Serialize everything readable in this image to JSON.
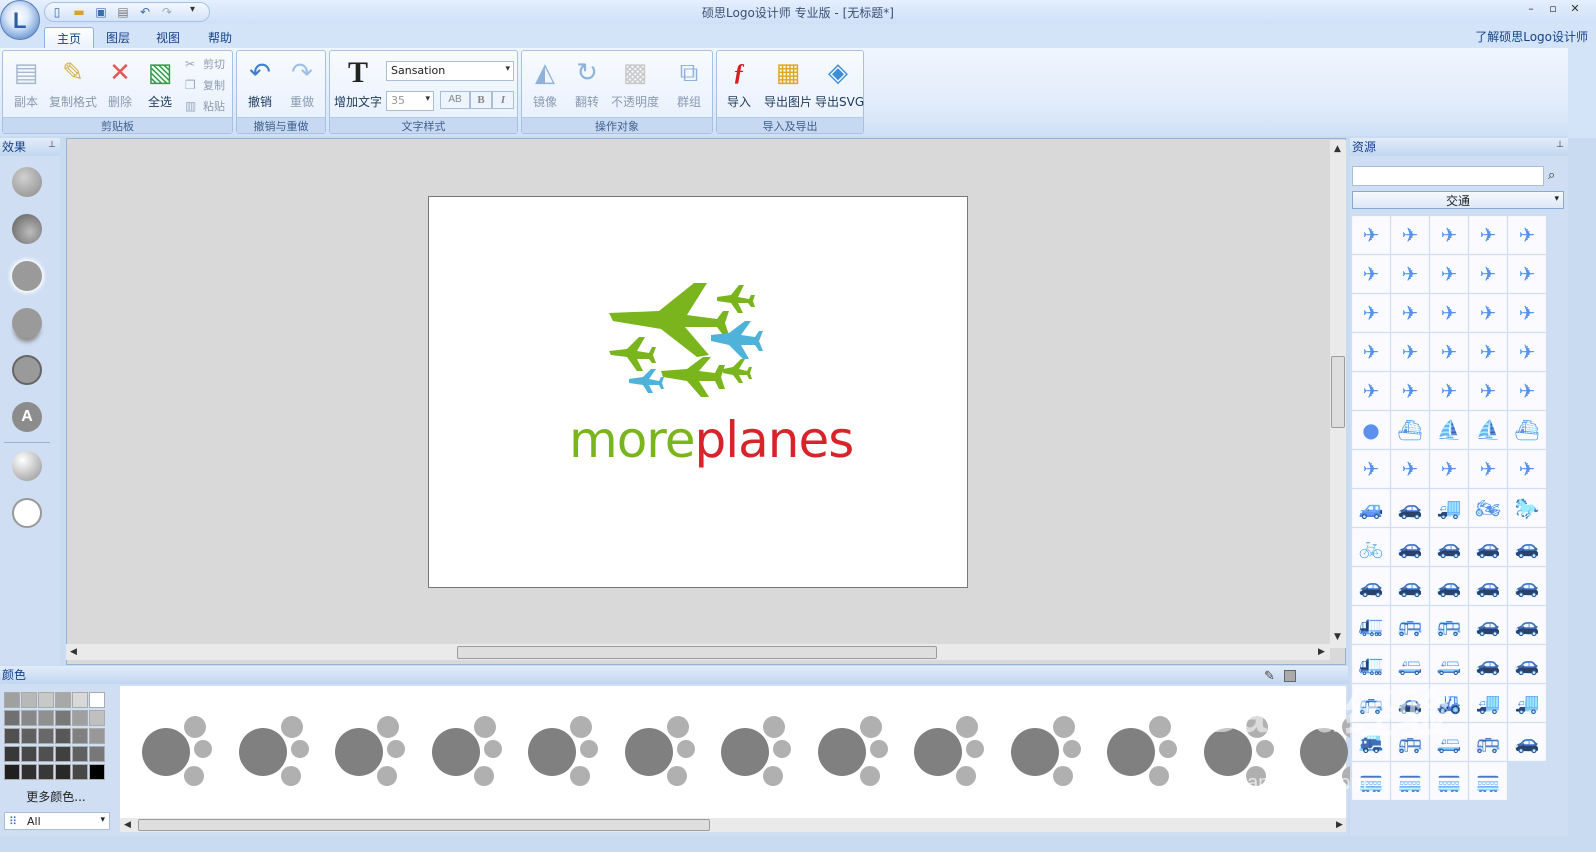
{
  "titlebar": {
    "title": "硕思Logo设计师 专业版 - [无标题*]",
    "minimize": "–",
    "restore": "▫",
    "close": "✕"
  },
  "app": {
    "logo": "L"
  },
  "quick_access": {
    "icons": [
      "new-file-icon",
      "open-folder-icon",
      "save-icon",
      "print-icon",
      "undo-icon",
      "redo-icon"
    ],
    "more": "▾"
  },
  "tabs": [
    "主页",
    "图层",
    "视图",
    "帮助"
  ],
  "about_link": "了解硕思Logo设计师",
  "ribbon": {
    "clipboard": {
      "label": "剪贴板",
      "copy_page": "副本",
      "format_painter": "复制格式",
      "delete": "删除",
      "select_all": "全选",
      "cut": "剪切",
      "copy": "复制",
      "paste": "粘贴"
    },
    "undo_redo": {
      "label": "撤销与重做",
      "undo": "撤销",
      "redo": "重做"
    },
    "text_style": {
      "label": "文字样式",
      "add_text": "增加文字",
      "font": "Sansation",
      "size": "35",
      "case": "AB",
      "bold": "B",
      "italic": "I"
    },
    "operations": {
      "label": "操作对象",
      "mirror": "镜像",
      "flip": "翻转",
      "opacity": "不透明度",
      "group": "群组"
    },
    "import_export": {
      "label": "导入及导出",
      "import": "导入",
      "export_image": "导出图片",
      "export_svg": "导出SVG"
    }
  },
  "effects_panel": {
    "title": "效果",
    "effect_text": "A"
  },
  "canvas": {
    "logo_word1": "more",
    "logo_word2": "planes"
  },
  "color_panel": {
    "title": "颜色",
    "more_colors": "更多颜色...",
    "filter": "All"
  },
  "resources_panel": {
    "title": "资源",
    "search_placeholder": "",
    "category": "交通"
  },
  "watermark": {
    "text": "Baidu经验",
    "url": "jingyan.baidu.com"
  },
  "colors": {
    "accent": "#15428b",
    "logo_green": "#7ab51d",
    "logo_red": "#d7242a",
    "logo_blue": "#4fb3d9",
    "resource_icon": "#4a78bd"
  }
}
